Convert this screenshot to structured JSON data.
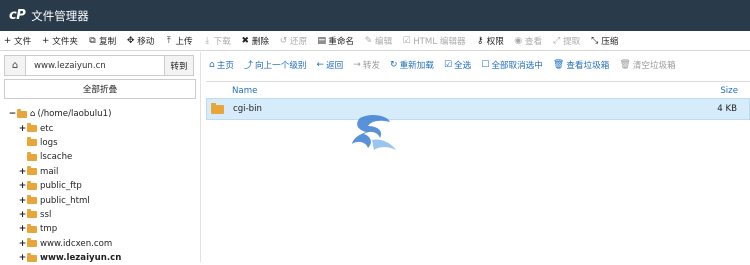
{
  "app": {
    "logo": "cP",
    "title": "文件管理器"
  },
  "toolbar": [
    {
      "icon": "+",
      "label": "文件",
      "disabled": false
    },
    {
      "icon": "+",
      "label": "文件夹",
      "disabled": false
    },
    {
      "icon": "⧉",
      "label": "复制",
      "disabled": false
    },
    {
      "icon": "✥",
      "label": "移动",
      "disabled": false
    },
    {
      "icon": "⤒",
      "label": "上传",
      "disabled": false
    },
    {
      "icon": "⤓",
      "label": "下载",
      "disabled": true
    },
    {
      "icon": "✖",
      "label": "删除",
      "disabled": false
    },
    {
      "icon": "↺",
      "label": "还原",
      "disabled": true
    },
    {
      "icon": "▤",
      "label": "重命名",
      "disabled": false
    },
    {
      "icon": "✎",
      "label": "编辑",
      "disabled": true
    },
    {
      "icon": "☑",
      "label": "HTML 编辑器",
      "disabled": true
    },
    {
      "icon": "⚷",
      "label": "权限",
      "disabled": false
    },
    {
      "icon": "◉",
      "label": "查看",
      "disabled": true
    },
    {
      "icon": "⤢",
      "label": "提取",
      "disabled": true
    },
    {
      "icon": "⤡",
      "label": "压缩",
      "disabled": false
    }
  ],
  "left": {
    "address": "www.lezaiyun.cn",
    "go_label": "转到",
    "collapse_label": "全部折叠",
    "tree": [
      {
        "exp": "−",
        "label": "(/home/laobulu1)",
        "indent": 0,
        "home": true,
        "bold": false
      },
      {
        "exp": "+",
        "label": "etc",
        "indent": 1,
        "home": false,
        "bold": false
      },
      {
        "exp": "",
        "label": "logs",
        "indent": 1,
        "home": false,
        "bold": false
      },
      {
        "exp": "",
        "label": "lscache",
        "indent": 1,
        "home": false,
        "bold": false
      },
      {
        "exp": "+",
        "label": "mail",
        "indent": 1,
        "home": false,
        "bold": false
      },
      {
        "exp": "+",
        "label": "public_ftp",
        "indent": 1,
        "home": false,
        "bold": false
      },
      {
        "exp": "+",
        "label": "public_html",
        "indent": 1,
        "home": false,
        "bold": false
      },
      {
        "exp": "+",
        "label": "ssl",
        "indent": 1,
        "home": false,
        "bold": false
      },
      {
        "exp": "+",
        "label": "tmp",
        "indent": 1,
        "home": false,
        "bold": false
      },
      {
        "exp": "+",
        "label": "www.idcxen.com",
        "indent": 1,
        "home": false,
        "bold": false
      },
      {
        "exp": "+",
        "label": "www.lezaiyun.cn",
        "indent": 1,
        "home": false,
        "bold": true
      }
    ]
  },
  "nav": [
    {
      "icon": "⌂",
      "label": "主页",
      "disabled": false
    },
    {
      "icon": "⤴",
      "label": "向上一个级别",
      "disabled": false
    },
    {
      "icon": "←",
      "label": "返回",
      "disabled": false
    },
    {
      "icon": "→",
      "label": "转发",
      "disabled": true
    },
    {
      "icon": "↻",
      "label": "重新加载",
      "disabled": false
    },
    {
      "icon": "☑",
      "label": "全选",
      "disabled": false
    },
    {
      "icon": "☐",
      "label": "全部取消选中",
      "disabled": false
    },
    {
      "icon": "🗑",
      "label": "查看垃圾箱",
      "disabled": false
    },
    {
      "icon": "🗑",
      "label": "清空垃圾箱",
      "disabled": true
    }
  ],
  "table": {
    "columns": {
      "name": "Name",
      "size": "Size"
    },
    "rows": [
      {
        "name": "cgi-bin",
        "size": "4 KB"
      }
    ]
  },
  "colors": {
    "titlebar": "#293a4a",
    "link": "#1f6fbf",
    "folder": "#e8a53a",
    "selected_row": "#d7ecfa"
  }
}
